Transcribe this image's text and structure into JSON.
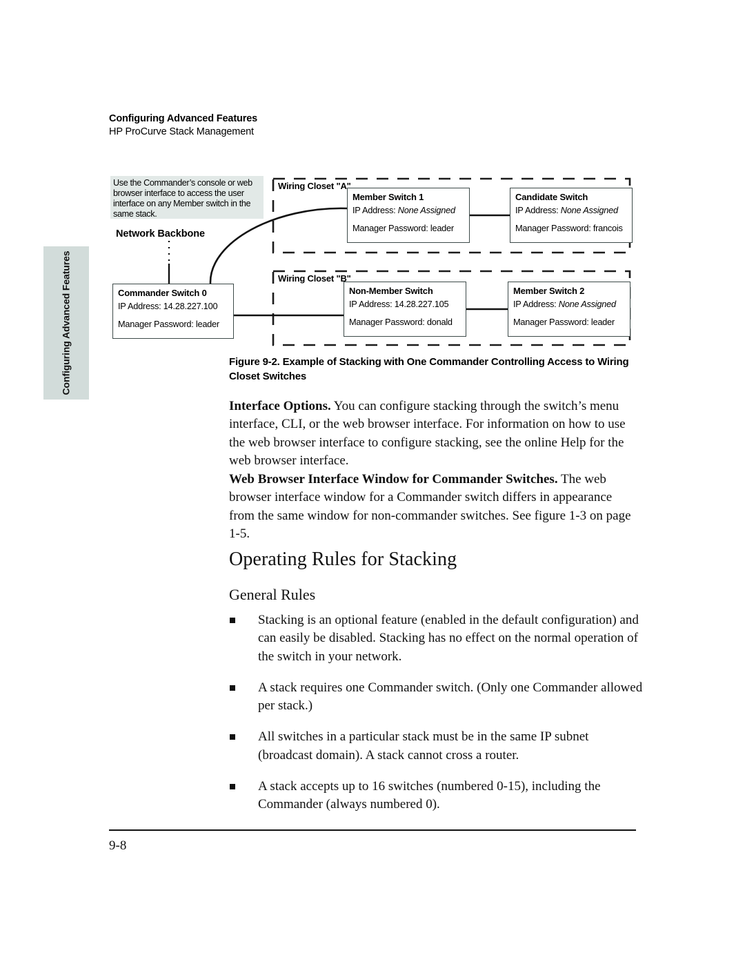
{
  "header": {
    "chapter": "Configuring Advanced Features",
    "subject": "HP ProCurve Stack Management"
  },
  "side_tab": {
    "text": "Configuring Advanced Features"
  },
  "figure": {
    "callout": "Use the Commander’s console or web browser interface to access the user interface on any Member switch in the same stack.",
    "backbone_label": "Network Backbone",
    "closet_a_label": "Wiring Closet \"A\"",
    "closet_b_label": "Wiring Closet \"B\"",
    "switches": {
      "commander": {
        "title": "Commander Switch 0",
        "ip_label": "IP Address: ",
        "ip_value": "14.28.227.100",
        "ip_italic": false,
        "password_label": "Manager Password: ",
        "password_value": "leader"
      },
      "member1": {
        "title": "Member Switch 1",
        "ip_label": "IP Address: ",
        "ip_value": "None Assigned",
        "ip_italic": true,
        "password_label": "Manager Password: ",
        "password_value": "leader"
      },
      "candidate": {
        "title": "Candidate Switch",
        "ip_label": "IP Address: ",
        "ip_value": "None Assigned",
        "ip_italic": true,
        "password_label": "Manager Password: ",
        "password_value": "francois"
      },
      "nonmember": {
        "title": "Non-Member Switch",
        "ip_label": "IP Address: ",
        "ip_value": "14.28.227.105",
        "ip_italic": false,
        "password_label": "Manager Password: ",
        "password_value": "donald"
      },
      "member2": {
        "title": "Member Switch 2",
        "ip_label": "IP Address: ",
        "ip_value": "None Assigned",
        "ip_italic": true,
        "password_label": "Manager Password: ",
        "password_value": "leader"
      }
    },
    "caption": "Figure 9-2.  Example of Stacking with One Commander Controlling Access to Wiring Closet Switches"
  },
  "body": {
    "interface_options": {
      "lead": "Interface Options.",
      "text": "  You can configure stacking through the switch’s menu interface, CLI, or the web browser interface. For information on how to use the web browser interface to configure stacking, see the online Help for the web browser interface."
    },
    "web_browser_interface": {
      "lead": "Web Browser Interface Window for Commander Switches.",
      "text": "  The web browser interface window for a Commander switch differs in appearance from the same window for non-commander switches. See figure 1-3 on page 1-5."
    },
    "heading_operating_rules": "Operating Rules for Stacking",
    "heading_general_rules": "General Rules",
    "rules": [
      "Stacking is an optional feature (enabled in the default configuration) and can easily be disabled. Stacking has no effect on the normal operation of the switch in your network.",
      "A stack requires one Commander switch. (Only one Commander allowed per stack.)",
      "All switches in a particular stack must be in the same IP subnet (broadcast domain). A stack cannot cross a router.",
      "A stack accepts up to 16 switches (numbered 0-15), including the Commander (always numbered 0)."
    ]
  },
  "footer": {
    "page_number": "9-8"
  },
  "colors": {
    "side_tab_bg": "#d2dcda",
    "callout_bg": "#e2e9e7",
    "ink": "#111111",
    "box_border": "#3d4a49"
  }
}
